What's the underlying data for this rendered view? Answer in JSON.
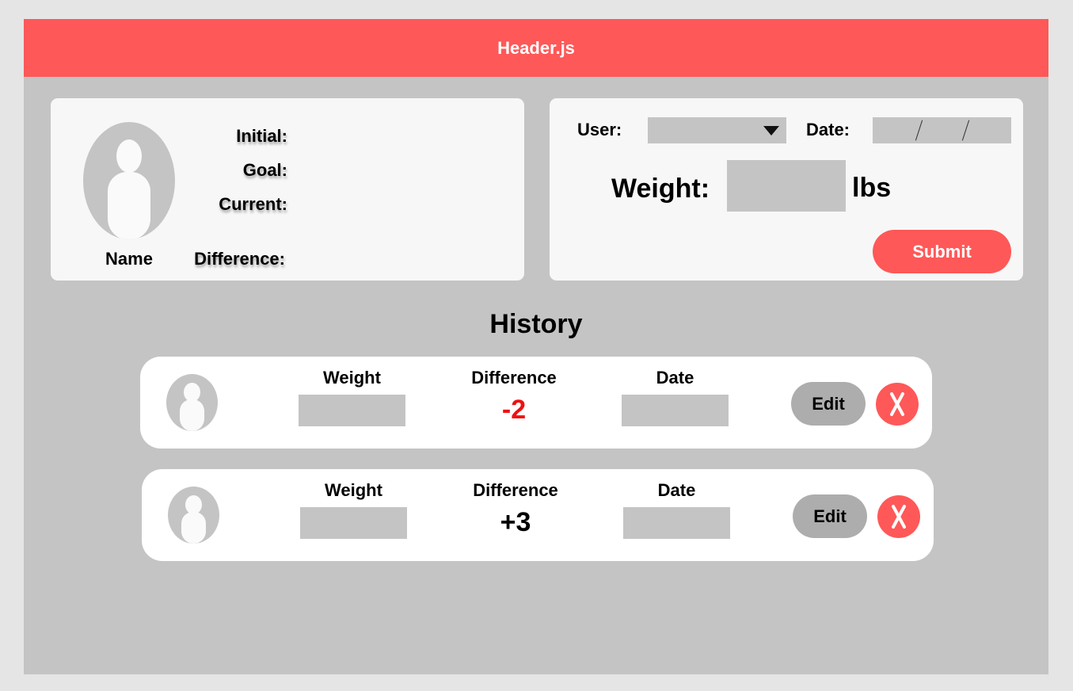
{
  "header": {
    "title": "Header.js"
  },
  "profile": {
    "name": "Name",
    "labels": {
      "initial": "Initial:",
      "goal": "Goal:",
      "current": "Current:",
      "difference": "Difference:"
    }
  },
  "form": {
    "user_label": "User:",
    "user_value": "",
    "date_label": "Date:",
    "date_value": "",
    "weight_label": "Weight:",
    "weight_value": "",
    "unit": "lbs",
    "submit_label": "Submit"
  },
  "history": {
    "title": "History",
    "columns": {
      "weight": "Weight",
      "difference": "Difference",
      "date": "Date"
    },
    "rows": [
      {
        "weight": "",
        "difference": "-2",
        "date": "",
        "edit_label": "Edit",
        "diff_color": "#ee1111"
      },
      {
        "weight": "",
        "difference": "+3",
        "date": "",
        "edit_label": "Edit",
        "diff_color": "#000000"
      }
    ]
  },
  "colors": {
    "accent": "#ff5858",
    "panel": "#c4c4c4",
    "card": "#f7f7f7",
    "negative": "#ee1111"
  },
  "icons": {
    "avatar": "avatar-icon",
    "dropdown": "chevron-down-icon",
    "delete": "close-icon"
  }
}
